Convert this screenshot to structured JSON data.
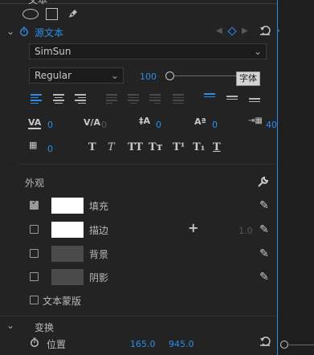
{
  "top_header": {
    "partial_label": "文本"
  },
  "section": {
    "source_text_label": "源文本",
    "font_family": "SimSun",
    "font_style": "Regular",
    "font_size": "100",
    "tooltip": "字体",
    "tracking_value": "0",
    "kerning_value": "0",
    "leading_value": "0",
    "baseline_value": "0",
    "tsume_value": "0",
    "width_value": "40"
  },
  "appearance": {
    "title": "外观",
    "fill_label": "填充",
    "stroke_label": "描边",
    "stroke_width": "1.0",
    "background_label": "背景",
    "shadow_label": "阴影",
    "text_mask_label": "文本蒙版",
    "fill_checked": true
  },
  "transform": {
    "title": "变换",
    "position_label": "位置",
    "position_x": "165.0",
    "position_y": "945.0"
  },
  "colors": {
    "accent": "#2d8ceb",
    "fill_swatch": "#ffffff",
    "stroke_swatch": "#ffffff",
    "background_swatch": "#4a4a4a",
    "shadow_swatch": "#4a4a4a"
  },
  "style_buttons": [
    "T",
    "T",
    "TT",
    "Tт",
    "T¹",
    "T₁",
    "T"
  ]
}
